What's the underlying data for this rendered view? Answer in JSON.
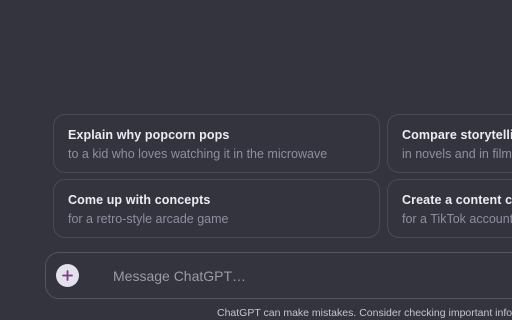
{
  "suggestions": [
    {
      "title": "Explain why popcorn pops",
      "subtitle": "to a kid who loves watching it in the microwave"
    },
    {
      "title": "Compare storytelling",
      "subtitle": "in novels and in films"
    },
    {
      "title": "Come up with concepts",
      "subtitle": "for a retro-style arcade game"
    },
    {
      "title": "Create a content calendar",
      "subtitle": "for a TikTok account"
    }
  ],
  "composer": {
    "placeholder": "Message ChatGPT…",
    "attach_icon": "plus-icon"
  },
  "footer": {
    "disclaimer": "ChatGPT can make mistakes. Consider checking important information."
  },
  "colors": {
    "background": "#34343f",
    "card_border": "#4a4a56",
    "title_text": "#ececf1",
    "subtitle_text": "#8e8ea0",
    "attach_button_bg": "#e3e1ec",
    "attach_icon_color": "#7a3a8a"
  }
}
